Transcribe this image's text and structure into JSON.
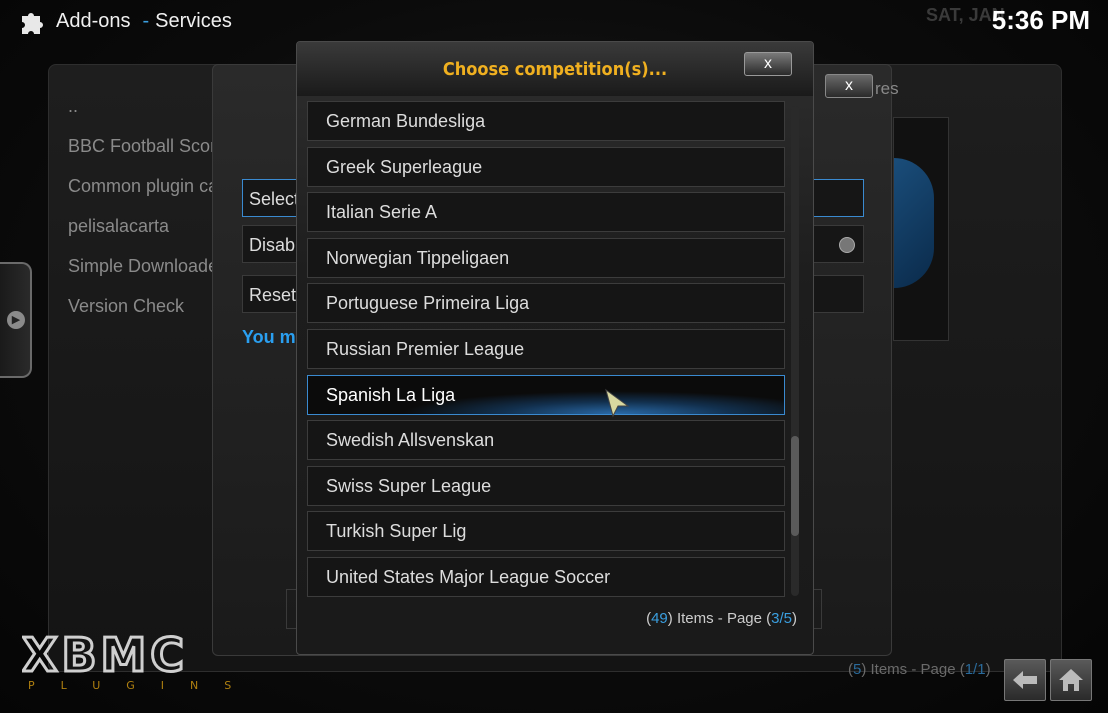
{
  "header": {
    "section": "Add-ons",
    "separator": "-",
    "subsection": "Services",
    "date_partial": "SAT, JAN",
    "time": "5:36 PM"
  },
  "addon_list": {
    "items": [
      {
        "label": ".."
      },
      {
        "label": "BBC Football Score"
      },
      {
        "label": "Common plugin ca"
      },
      {
        "label": "pelisalacarta"
      },
      {
        "label": "Simple Downloade"
      },
      {
        "label": "Version Check"
      }
    ]
  },
  "settings_dialog": {
    "close_label": "x",
    "title_partial": "res",
    "rows": [
      {
        "label": "Select c"
      },
      {
        "label": "Disable"
      },
      {
        "label": "Reset c"
      }
    ],
    "warning": "You mu"
  },
  "dialog": {
    "title": "Choose competition(s)...",
    "close_label": "x",
    "items": [
      {
        "label": "German Bundesliga"
      },
      {
        "label": "Greek Superleague"
      },
      {
        "label": "Italian Serie A"
      },
      {
        "label": "Norwegian Tippeligaen"
      },
      {
        "label": "Portuguese Primeira Liga"
      },
      {
        "label": "Russian Premier League"
      },
      {
        "label": "Spanish La Liga"
      },
      {
        "label": "Swedish Allsvenskan"
      },
      {
        "label": "Swiss Super League"
      },
      {
        "label": "Turkish Super Lig"
      },
      {
        "label": "United States Major League Soccer"
      }
    ],
    "focused_index": 6,
    "footer": {
      "open": "(",
      "items_count": "49",
      "items_text": ") Items - Page (",
      "page": "3/5",
      "close": ")"
    }
  },
  "bottom_status": {
    "open": "(",
    "items_count": "5",
    "items_text": ") Items - Page (",
    "page": "1/1",
    "close": ")"
  },
  "brand": {
    "logo_text": "XBMC",
    "logo_sub": "PLUGINS"
  },
  "colors": {
    "accent": "#3a9fe0",
    "title": "#f0b020"
  }
}
